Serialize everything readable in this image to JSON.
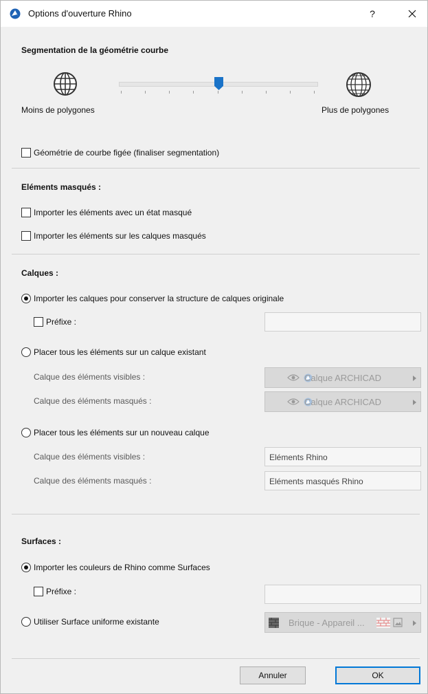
{
  "window": {
    "title": "Options d'ouverture Rhino",
    "help_label": "?"
  },
  "segmentation": {
    "heading": "Segmentation de la géométrie courbe",
    "slider_value": 0.5,
    "min_label": "Moins de polygones",
    "max_label": "Plus de polygones",
    "freeze_label": "Géométrie de courbe figée (finaliser segmentation)"
  },
  "hidden": {
    "heading": "Eléments masqués :",
    "opt1": "Importer les éléments avec un état masqué",
    "opt2": "Importer les éléments sur les calques masqués"
  },
  "layers": {
    "heading": "Calques :",
    "radio1": "Importer les calques pour conserver la structure de calques originale",
    "prefix_label": "Préfixe :",
    "radio2": "Placer tous les éléments sur un calque existant",
    "visible_label": "Calque des éléments visibles :",
    "hidden_label": "Calque des éléments masqués :",
    "existing_visible": "Calque ARCHICAD",
    "existing_hidden": "Calque ARCHICAD",
    "radio3": "Placer tous les éléments sur un nouveau calque",
    "new_visible_label": "Calque des éléments visibles :",
    "new_hidden_label": "Calque des éléments masqués :",
    "new_visible_value": "Eléments Rhino",
    "new_hidden_value": "Eléments masqués Rhino"
  },
  "surfaces": {
    "heading": "Surfaces :",
    "radio1": "Importer les couleurs de Rhino comme Surfaces",
    "prefix_label": "Préfixe :",
    "radio2": "Utiliser Surface uniforme existante",
    "surface_value": "Brique - Appareil ..."
  },
  "buttons": {
    "cancel": "Annuler",
    "ok": "OK"
  },
  "colors": {
    "accent": "#0078d7",
    "slider_thumb": "#1a73c8"
  }
}
